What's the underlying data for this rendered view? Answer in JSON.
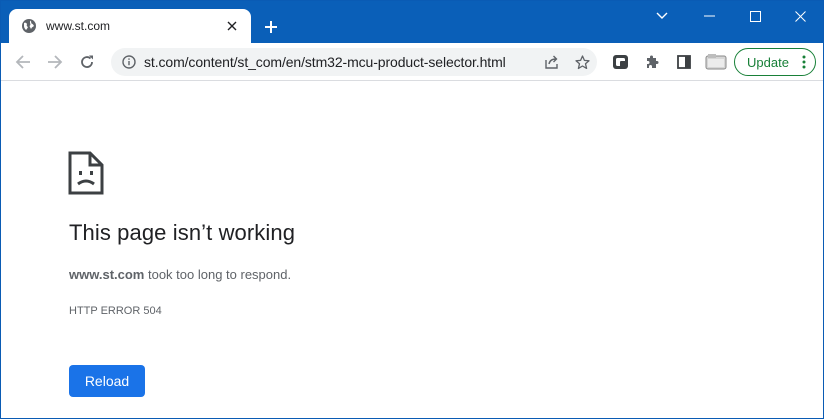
{
  "browser": {
    "tab": {
      "title": "www.st.com",
      "favicon": "globe-icon"
    },
    "new_tab_icon": "plus-icon",
    "window_controls": [
      "chevron-down-icon",
      "minimize-icon",
      "maximize-icon",
      "close-icon"
    ],
    "address_bar": {
      "url": "st.com/content/st_com/en/stm32-mcu-product-selector.html",
      "security_icon": "info-icon"
    },
    "update_label": "Update",
    "colors": {
      "frame": "#0a5fb8",
      "update_green": "#188038",
      "button_blue": "#1a73e8"
    }
  },
  "error_page": {
    "title": "This page isn’t working",
    "host": "www.st.com",
    "description_suffix": " took too long to respond.",
    "code": "HTTP ERROR 504",
    "reload_label": "Reload",
    "icon": "sad-page-icon"
  }
}
